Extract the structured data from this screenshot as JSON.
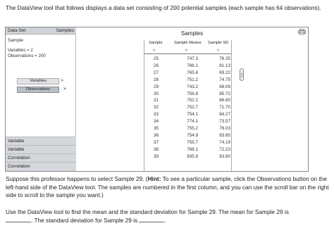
{
  "intro": "The DataView tool that follows displays a data set consisting of 200 potential samples (each sample has 64 observations).",
  "left_panel": {
    "data_set_label": "Data Set",
    "samples_label": "Samples",
    "sample_label": "Sample",
    "variables_info": "Variables = 2",
    "observations_info": "Observations = 200",
    "variables_button": "Variables",
    "observations_button": "Observations",
    "arrow": ">",
    "stat_rows": [
      "Variable",
      "Variable",
      "Correlation",
      "Correlation"
    ]
  },
  "main": {
    "title": "Samples",
    "columns": [
      "Sample",
      "Sample Means",
      "Sample SD"
    ],
    "sort_glyph": "▿",
    "rows": [
      [
        "25",
        "747.3",
        "76.35"
      ],
      [
        "26",
        "766.1",
        "81.13"
      ],
      [
        "27",
        "765.8",
        "69.22"
      ],
      [
        "28",
        "751.2",
        "74.75"
      ],
      [
        "29",
        "743.2",
        "88.09"
      ],
      [
        "30",
        "756.8",
        "85.72"
      ],
      [
        "31",
        "752.2",
        "86.60"
      ],
      [
        "32",
        "752.7",
        "71.70"
      ],
      [
        "33",
        "754.1",
        "84.27"
      ],
      [
        "34",
        "774.1",
        "73.57"
      ],
      [
        "35",
        "755.2",
        "76.03"
      ],
      [
        "36",
        "754.9",
        "83.65"
      ],
      [
        "37",
        "755.7",
        "74.19"
      ],
      [
        "38",
        "768.1",
        "72.23"
      ],
      [
        "39",
        "835.8",
        "83.80"
      ]
    ]
  },
  "para1": {
    "before": "Suppose this professor happens to select Sample 29. (",
    "hint_label": "Hint:",
    "after": " To see a particular sample, click the Observations button on the left-hand side of the DataView tool. The samples are numbered in the first column, and you can use the scroll bar on the right side to scroll to the sample you want.)"
  },
  "para2": {
    "line1": "Use the DataView tool to find the mean and the standard deviation for Sample 29. The mean for Sample 29 is",
    "mid": ". The standard deviation for Sample 29 is",
    "end": "."
  }
}
